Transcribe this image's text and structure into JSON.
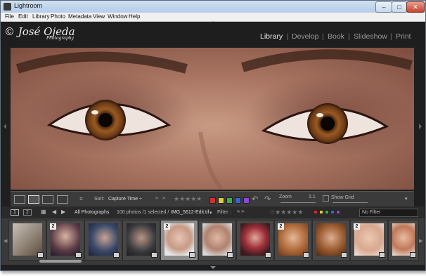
{
  "window": {
    "title": "Lightroom",
    "min": "–",
    "max": "□",
    "close": "✕"
  },
  "menu": [
    "File",
    "Edit",
    "Library",
    "Photo",
    "Metadata",
    "View",
    "Window",
    "Help"
  ],
  "identity": {
    "logo_main": "© José Ojeda",
    "logo_sub": "Photography"
  },
  "modules": {
    "library": "Library",
    "develop": "Develop",
    "book": "Book",
    "slideshow": "Slideshow",
    "print": "Print",
    "separator": "|"
  },
  "toolbar": {
    "sort_label": "Sort:",
    "sort_value": "Capture Time ÷",
    "zoom_label": "Zoom",
    "zoom_value": "1:1",
    "show_grid": "Show Grid"
  },
  "filmstrip_bar": {
    "screen1": "1",
    "screen2": "2",
    "source": "All Photographs",
    "count": "100 photos /1 selected /",
    "filename": "IMG_5612-Edit.tif",
    "filename_caret": "▾",
    "filter_label": "Filter :",
    "filter_value": "No Filter"
  },
  "thumbnails": [
    {
      "badge": "",
      "selected": false
    },
    {
      "badge": "2",
      "selected": false
    },
    {
      "badge": "",
      "selected": false
    },
    {
      "badge": "",
      "selected": false
    },
    {
      "badge": "2",
      "selected": true
    },
    {
      "badge": "",
      "selected": false
    },
    {
      "badge": "",
      "selected": false
    },
    {
      "badge": "2",
      "selected": false
    },
    {
      "badge": "",
      "selected": false
    },
    {
      "badge": "2",
      "selected": false
    },
    {
      "badge": "",
      "selected": false
    }
  ],
  "colors": {
    "accent_label_colors": [
      "#d62c2c",
      "#e0c93a",
      "#3ab04a",
      "#3a62d6",
      "#8a4ad6"
    ]
  }
}
